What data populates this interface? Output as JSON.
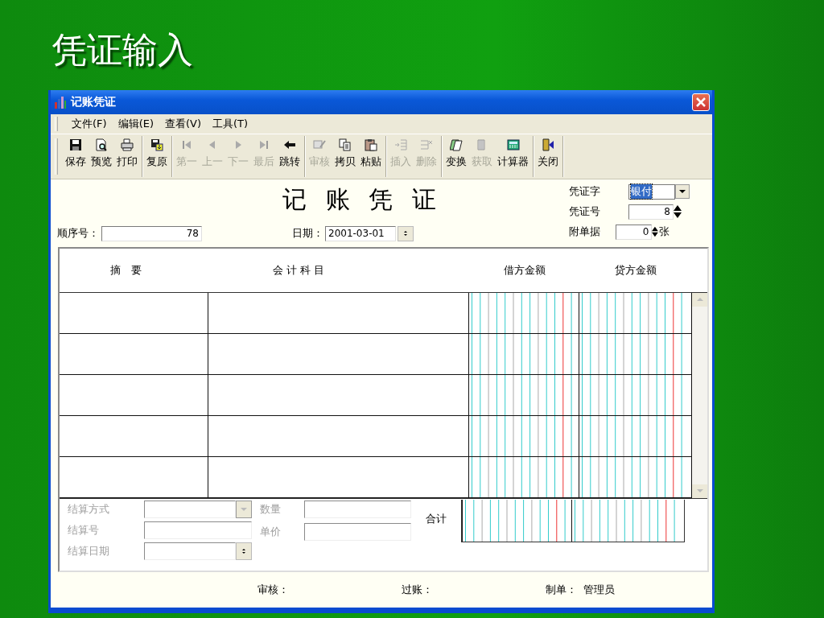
{
  "slide_title": "凭证输入",
  "window": {
    "title": "记账凭证"
  },
  "menu": [
    {
      "label": "文件(F)"
    },
    {
      "label": "编辑(E)"
    },
    {
      "label": "查看(V)"
    },
    {
      "label": "工具(T)"
    }
  ],
  "toolbar": [
    [
      {
        "label": "保存",
        "disabled": false
      },
      {
        "label": "预览",
        "disabled": false
      },
      {
        "label": "打印",
        "disabled": false
      }
    ],
    [
      {
        "label": "复原",
        "disabled": false
      }
    ],
    [
      {
        "label": "第一",
        "disabled": true
      },
      {
        "label": "上一",
        "disabled": true
      },
      {
        "label": "下一",
        "disabled": true
      },
      {
        "label": "最后",
        "disabled": true
      },
      {
        "label": "跳转",
        "disabled": false
      }
    ],
    [
      {
        "label": "审核",
        "disabled": true
      },
      {
        "label": "拷贝",
        "disabled": false
      },
      {
        "label": "粘贴",
        "disabled": false
      }
    ],
    [
      {
        "label": "插入",
        "disabled": true
      },
      {
        "label": "删除",
        "disabled": true
      }
    ],
    [
      {
        "label": "变换",
        "disabled": false
      },
      {
        "label": "获取",
        "disabled": true
      },
      {
        "label": "计算器",
        "disabled": false
      }
    ],
    [
      {
        "label": "关闭",
        "disabled": false
      }
    ]
  ],
  "form": {
    "title": "记 账 凭 证",
    "sequence": {
      "label": "顺序号：",
      "value": "78"
    },
    "date": {
      "label": "日期：",
      "value": "2001-03-01"
    },
    "voucher_type": {
      "label": "凭证字",
      "value": "银付",
      "selected": true
    },
    "voucher_no": {
      "label": "凭证号",
      "value": "8"
    },
    "attachments": {
      "label": "附单据",
      "value": "0",
      "unit": "张"
    }
  },
  "entries": {
    "columns": [
      "摘　要",
      "会 计 科 目",
      "借方金额",
      "贷方金额"
    ]
  },
  "settlement": {
    "disabled": true,
    "fields": [
      {
        "label": "结算方式",
        "kind": "dropdown"
      },
      {
        "label": "结算号",
        "kind": "text"
      },
      {
        "label": "结算日期",
        "kind": "spinner"
      }
    ],
    "extra_fields": [
      {
        "label": "数量"
      },
      {
        "label": "单价"
      }
    ],
    "total_label": "合计"
  },
  "signatures": [
    {
      "label": "审核："
    },
    {
      "label": "过账："
    },
    {
      "label": "制单：",
      "value": "管理员"
    }
  ]
}
